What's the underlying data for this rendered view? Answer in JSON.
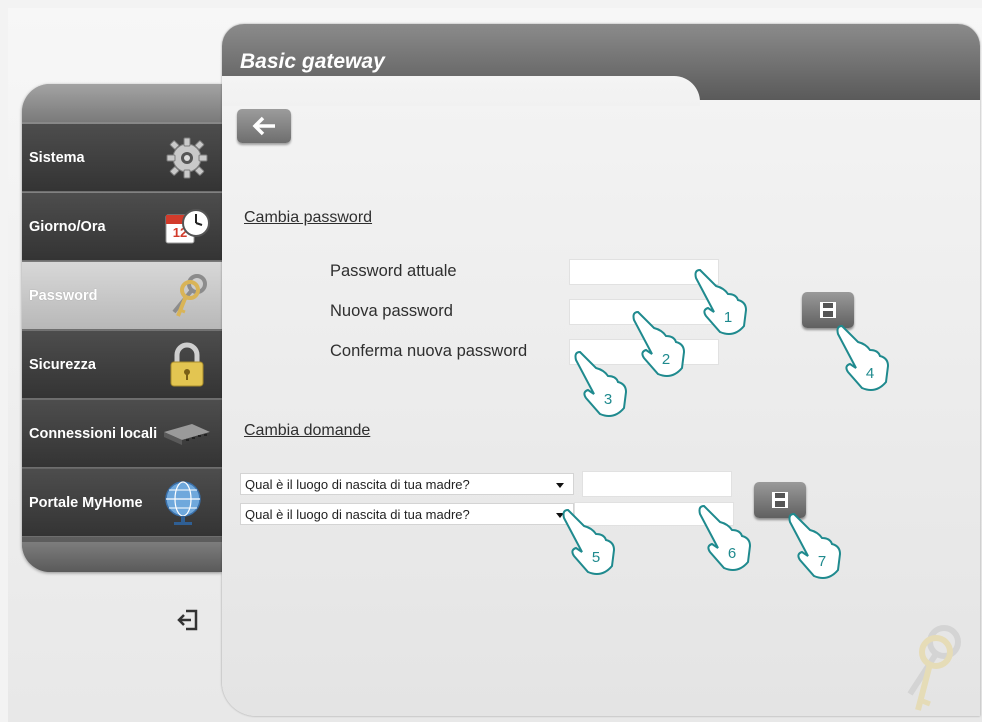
{
  "header": {
    "title": "Basic gateway"
  },
  "sidebar": {
    "items": [
      {
        "label": "Sistema",
        "icon": "gear-icon",
        "active": false
      },
      {
        "label": "Giorno/Ora",
        "icon": "calendar-clock-icon",
        "active": false
      },
      {
        "label": "Password",
        "icon": "keys-icon",
        "active": true
      },
      {
        "label": "Sicurezza",
        "icon": "padlock-icon",
        "active": false
      },
      {
        "label": "Connessioni locali",
        "icon": "network-switch-icon",
        "active": false
      },
      {
        "label": "Portale MyHome",
        "icon": "globe-icon",
        "active": false
      }
    ],
    "logout_icon": "logout-icon"
  },
  "password_section": {
    "title": "Cambia password",
    "current_label": "Password attuale",
    "current_value": "",
    "new_label": "Nuova password",
    "new_value": "",
    "confirm_label": "Conferma nuova password",
    "confirm_value": ""
  },
  "questions_section": {
    "title": "Cambia domande",
    "question1": "Qual è il luogo di nascita di tua madre?",
    "answer1": "",
    "question2": "Qual è il luogo di nascita di tua madre?",
    "answer2": ""
  },
  "callouts": [
    "1",
    "2",
    "3",
    "4",
    "5",
    "6",
    "7"
  ],
  "colors": {
    "accent": "#1f8a8e",
    "active_item": "#c8c8c8",
    "sidebar_dark": "#3d3d3d"
  }
}
